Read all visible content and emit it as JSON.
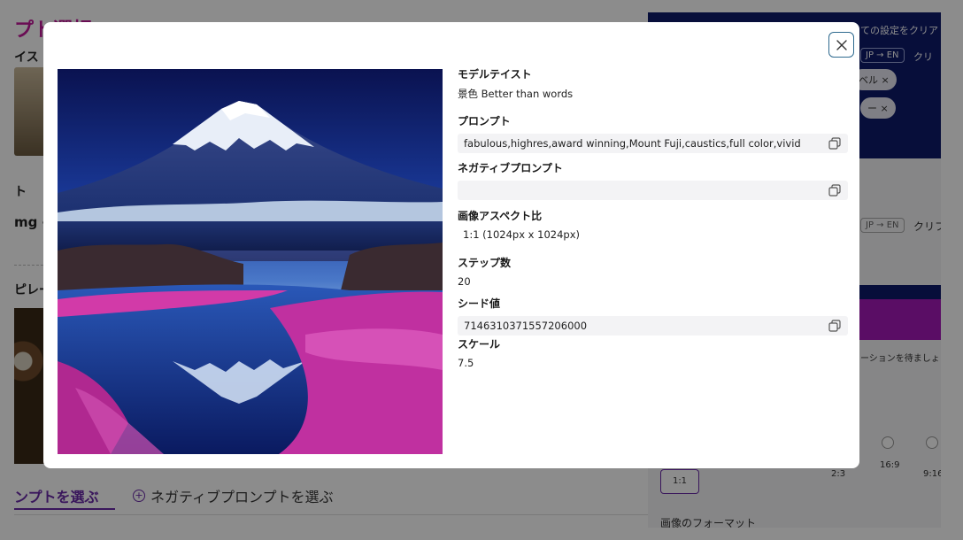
{
  "background": {
    "title": "プト選択",
    "text_1": "イス",
    "text_2": "ト",
    "text_3": "mg -",
    "text_4": "ピレー",
    "tabs": {
      "active": "ンプトを選ぶ",
      "negative": "ネガティブプロンプトを選ぶ"
    },
    "right": {
      "clear_text": "ての設定をクリア",
      "translate_pill": "JP → EN",
      "clip_text": "クリ",
      "chip_1": "ベル ×",
      "chip_2": "ー ×",
      "translate_pill_2": "JP → EN",
      "clip_text_2": "クリフ",
      "wait_text": "ーションを待ましょう",
      "ratios": [
        "1:1",
        "2:3",
        "16:9",
        "9:16"
      ],
      "format_label": "画像のフォーマット"
    }
  },
  "modal": {
    "close_icon": "close-icon",
    "copy_icon": "copy-icon",
    "image_alt": "Mount Fuji at night with pink flowers reflected in a lake",
    "fields": {
      "model_taste": {
        "label": "モデルテイスト",
        "value": "景色 Better than words"
      },
      "prompt": {
        "label": "プロンプト",
        "value": "fabulous,highres,award winning,Mount Fuji,caustics,full color,vivid"
      },
      "negative_prompt": {
        "label": "ネガティブプロンプト",
        "value": ""
      },
      "aspect_ratio": {
        "label": "画像アスペクト比",
        "value": "1:1 (1024px x 1024px)"
      },
      "steps": {
        "label": "ステップ数",
        "value": "20"
      },
      "seed": {
        "label": "シード値",
        "value": "7146310371557206000"
      },
      "scale": {
        "label": "スケール",
        "value": "7.5"
      }
    }
  },
  "colors": {
    "accent": "#6a2aa8",
    "brand_magenta": "#c2189a",
    "navy": "#0d1a6b",
    "close_border": "#2f6a8f"
  }
}
